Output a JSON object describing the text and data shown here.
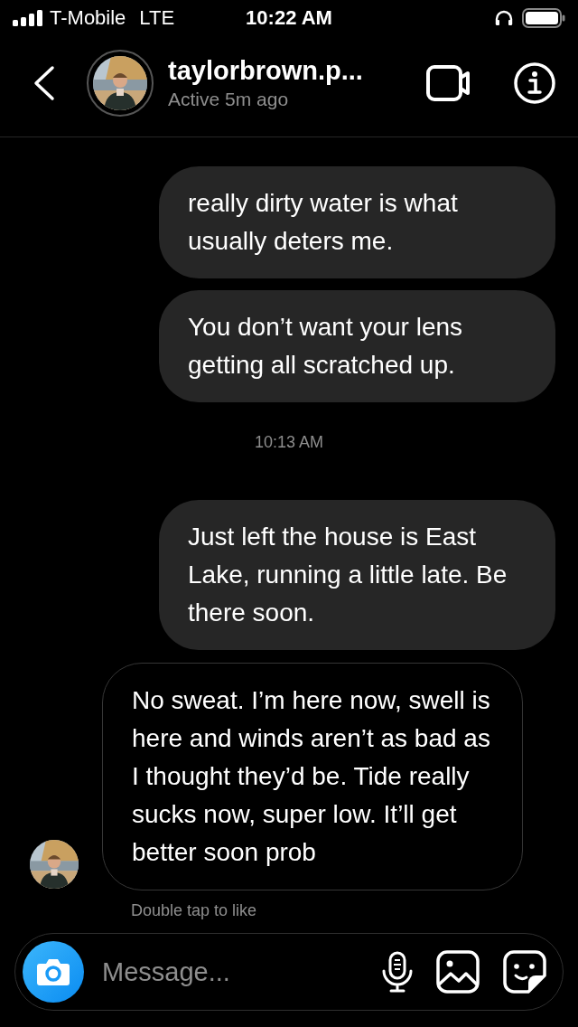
{
  "status_bar": {
    "carrier": "T-Mobile",
    "network": "LTE",
    "time": "10:22 AM"
  },
  "header": {
    "username": "taylorbrown.p...",
    "status": "Active 5m ago"
  },
  "messages": [
    {
      "kind": "sent",
      "text": "really dirty water is what usually deters me."
    },
    {
      "kind": "sent",
      "text": "You don’t want your lens getting all scratched up."
    },
    {
      "kind": "timestamp",
      "text": "10:13 AM"
    },
    {
      "kind": "sent",
      "text": "Just left the house is East Lake, running a little late. Be there soon."
    },
    {
      "kind": "received",
      "text": "No sweat. I’m here now, swell is here and winds aren’t as bad as I thought they’d be. Tide really sucks now, super low. It’ll get better soon prob"
    }
  ],
  "hint": "Double tap to like",
  "composer": {
    "placeholder": "Message..."
  }
}
